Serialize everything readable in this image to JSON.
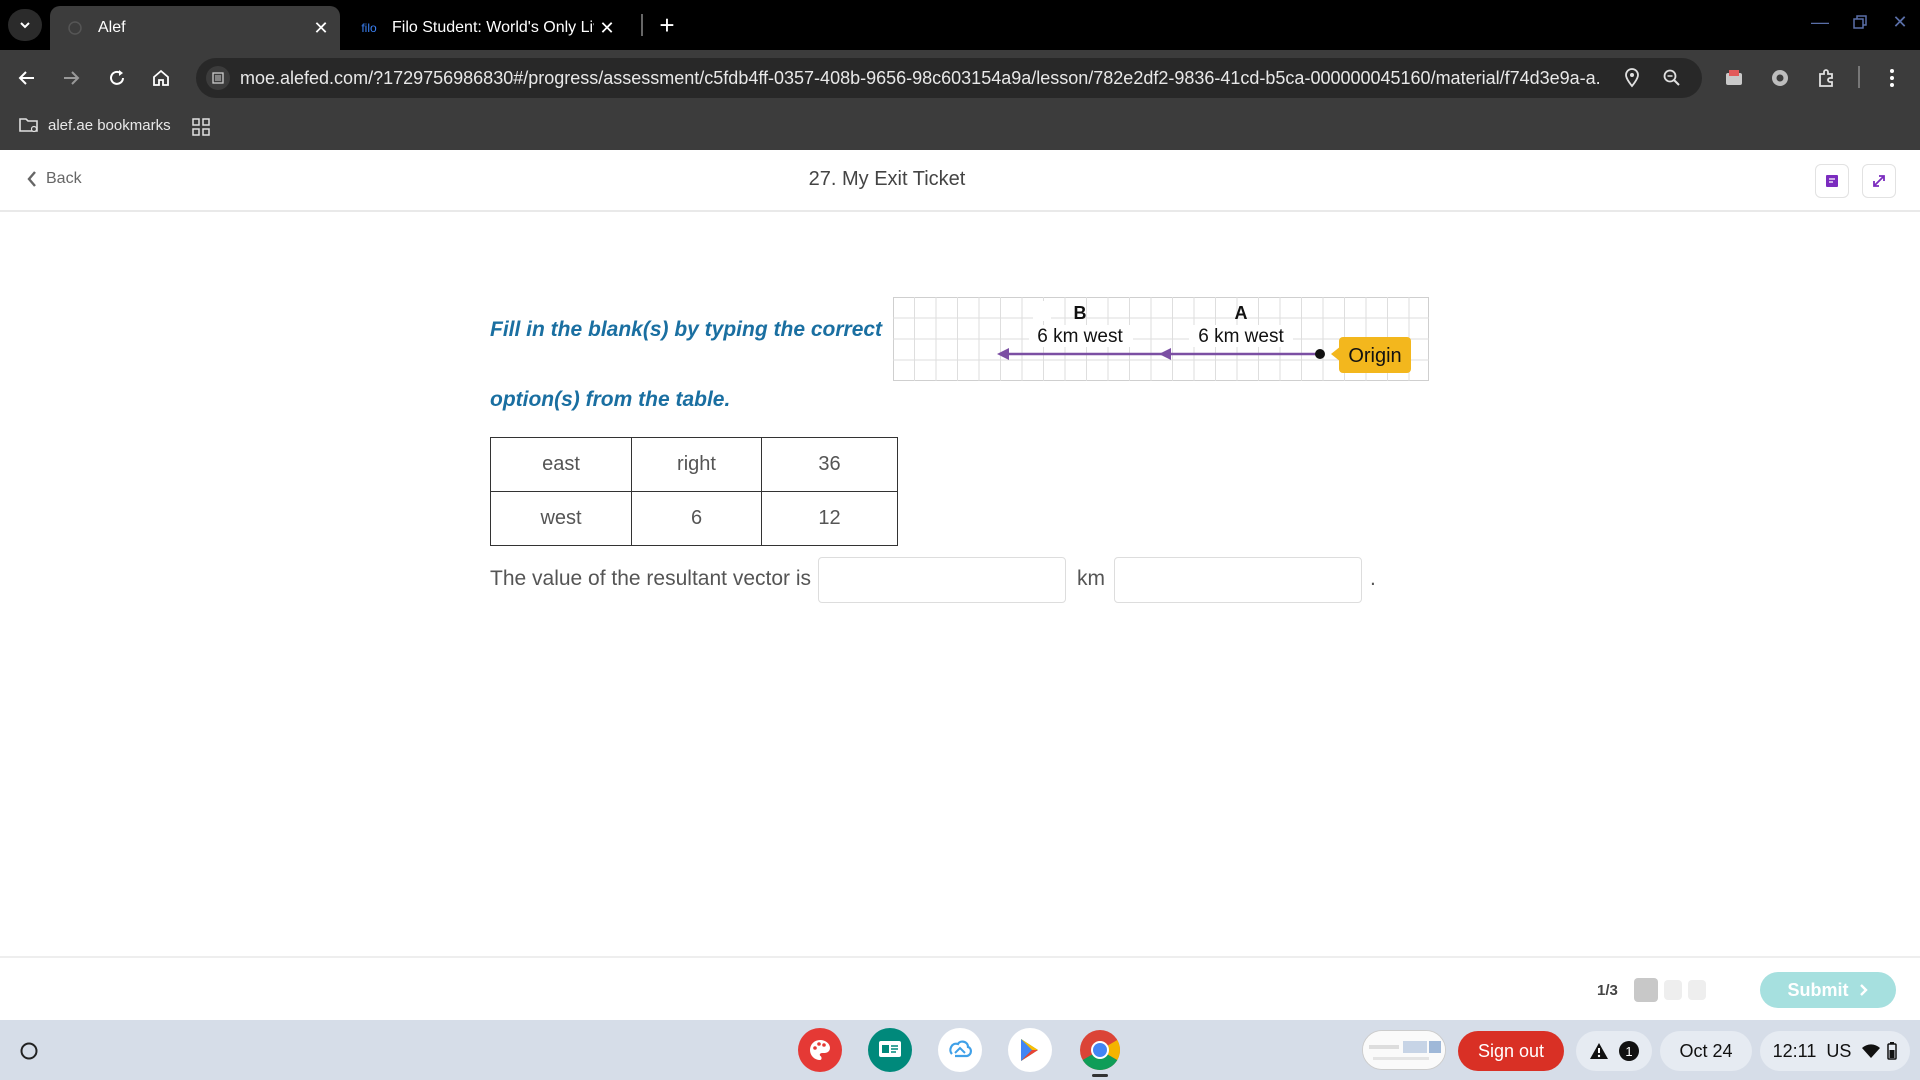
{
  "browser": {
    "tabs": [
      {
        "title": "Alef",
        "active": true
      },
      {
        "title": "Filo Student: World's Only Live I",
        "favicon_text": "filo",
        "active": false
      }
    ],
    "url": "moe.alefed.com/?1729756986830#/progress/assessment/c5fdb4ff-0357-408b-9656-98c603154a9a/lesson/782e2df2-9836-41cd-b5ca-000000045160/material/f74d3e9a-a...",
    "bookmarks": [
      {
        "label": "alef.ae bookmarks"
      }
    ]
  },
  "header": {
    "back_label": "Back",
    "title": "27. My Exit Ticket"
  },
  "question": {
    "instruction_line1": "Fill in the blank(s) by typing the correct",
    "instruction_line2": "option(s) from the table.",
    "options": [
      [
        "east",
        "right",
        "36"
      ],
      [
        "west",
        "6",
        "12"
      ]
    ],
    "sentence_prefix": "The value of the resultant vector is",
    "unit": "km",
    "end_punct": ".",
    "blank1_value": "",
    "blank2_value": ""
  },
  "diagram": {
    "vector_b": {
      "label": "B",
      "text": "6 km west"
    },
    "vector_a": {
      "label": "A",
      "text": "6 km west"
    },
    "origin_label": "Origin",
    "arrow_color": "#7b4fa3",
    "origin_color": "#f3b71d"
  },
  "footer": {
    "page_indicator": "1/3",
    "submit_label": "Submit",
    "submit_color": "#a6e0df"
  },
  "shelf": {
    "signout_label": "Sign out",
    "notification_count": "1",
    "date": "Oct 24",
    "time": "12:11",
    "locale": "US"
  }
}
